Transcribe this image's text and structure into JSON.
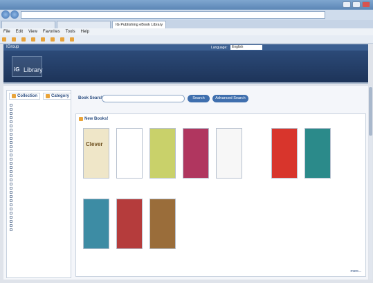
{
  "browser": {
    "title": "",
    "address": "",
    "tabs": [
      {
        "label": "",
        "active": false
      },
      {
        "label": "",
        "active": false
      },
      {
        "label": "IG Publishing eBook Library",
        "active": true
      }
    ],
    "menu": [
      "File",
      "Edit",
      "View",
      "Favorites",
      "Tools",
      "Help"
    ],
    "favorites": [
      {
        "label": ""
      },
      {
        "label": ""
      },
      {
        "label": ""
      },
      {
        "label": ""
      },
      {
        "label": ""
      },
      {
        "label": ""
      },
      {
        "label": ""
      },
      {
        "label": ""
      }
    ]
  },
  "header": {
    "brand": "IGroup",
    "language_label": "Language:",
    "language_value": "English",
    "links": ""
  },
  "banner": {
    "logo_ig": "iG",
    "logo_lib": "Library",
    "top_right": "",
    "institution": ""
  },
  "sidebar": {
    "tabs": [
      "Collection",
      "Category"
    ],
    "publishers": [
      "",
      "",
      "",
      "",
      "",
      "",
      "",
      "",
      "",
      "",
      "",
      "",
      "",
      "",
      "",
      "",
      "",
      "",
      "",
      "",
      "",
      "",
      "",
      "",
      "",
      "",
      "",
      "",
      "",
      "",
      ""
    ]
  },
  "search": {
    "label": "Book Search:",
    "button": "Search",
    "advanced": "Advanced Search"
  },
  "newbooks": {
    "heading": "New Books!",
    "more": "more...",
    "items": [
      {
        "title": "",
        "author": "",
        "cover_text": "Clever",
        "color": "#efe6c8",
        "text_color": "#6b4d1c"
      },
      {
        "title": "",
        "author": "",
        "cover_text": "",
        "color": "#ffffff",
        "text_color": "#333"
      },
      {
        "title": "",
        "author": "",
        "cover_text": "",
        "color": "#c9d16a",
        "text_color": "#333"
      },
      {
        "title": "",
        "author": "",
        "cover_text": "",
        "color": "#b0365f",
        "text_color": "#fff"
      },
      {
        "title": "",
        "author": "",
        "cover_text": "",
        "color": "#f7f7f7",
        "text_color": "#333"
      },
      {
        "title": "",
        "author": "",
        "cover_text": "",
        "color": "#d8352c",
        "text_color": "#fff"
      },
      {
        "title": "",
        "author": "",
        "cover_text": "",
        "color": "#2b8a8a",
        "text_color": "#fff"
      },
      {
        "title": "",
        "author": "",
        "cover_text": "",
        "color": "#3d8ca4",
        "text_color": "#fff"
      },
      {
        "title": "",
        "author": "",
        "cover_text": "",
        "color": "#b53c3c",
        "text_color": "#fff"
      },
      {
        "title": "",
        "author": "",
        "cover_text": "",
        "color": "#9a6d3a",
        "text_color": "#fff"
      }
    ]
  },
  "colors": {
    "header": "#3b5f91",
    "banner": "#2c4a78",
    "link": "#2d4f82",
    "button": "#3f6fae"
  }
}
